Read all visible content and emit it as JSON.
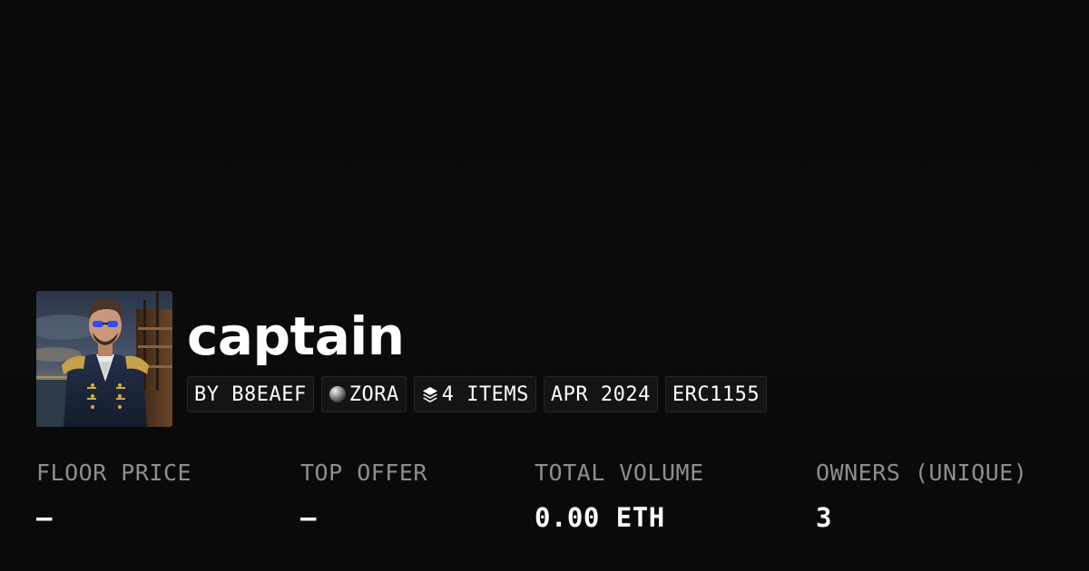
{
  "collection": {
    "title": "captain",
    "avatar_icon": "captain-portrait-avatar"
  },
  "chips": {
    "creator": "BY B8EAEF",
    "chain": "ZORA",
    "chain_icon": "zora-orb-icon",
    "items": "4 ITEMS",
    "items_icon": "layers-icon",
    "date": "APR 2024",
    "standard": "ERC1155"
  },
  "stats": {
    "floor_price": {
      "label": "FLOOR PRICE",
      "value": "–"
    },
    "top_offer": {
      "label": "TOP OFFER",
      "value": "–"
    },
    "total_volume": {
      "label": "TOTAL VOLUME",
      "value": "0.00 ETH"
    },
    "owners": {
      "label": "OWNERS (UNIQUE)",
      "value": "3"
    }
  },
  "colors": {
    "background": "#0b0b0b",
    "chip_background": "#141414",
    "label_gray": "#8e8e8e",
    "text_white": "#ffffff"
  }
}
